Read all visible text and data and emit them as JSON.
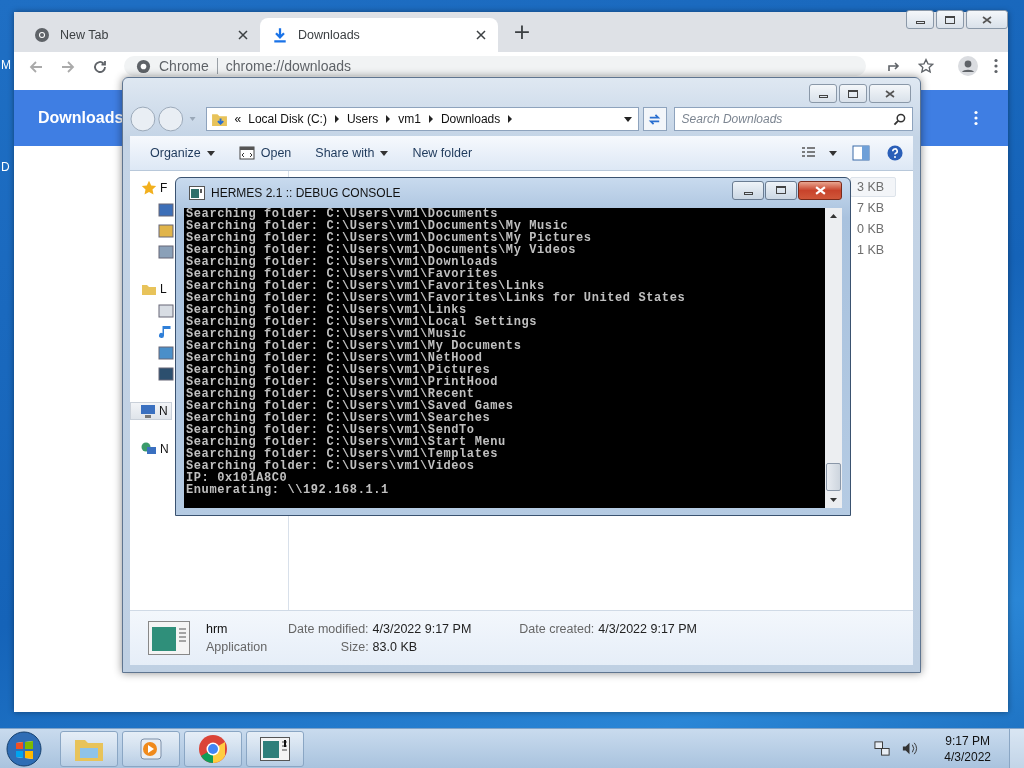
{
  "desktop": {
    "icon_labels": [
      "M",
      "D"
    ]
  },
  "browser": {
    "tabs": [
      {
        "title": "New Tab",
        "selected": false
      },
      {
        "title": "Downloads",
        "selected": true
      }
    ],
    "new_tab": "+",
    "address": {
      "site_label": "Chrome",
      "url": "chrome://downloads"
    },
    "page_title": "Downloads"
  },
  "explorer": {
    "breadcrumb_prefix": "«",
    "breadcrumb": [
      "Local Disk (C:)",
      "Users",
      "vm1",
      "Downloads"
    ],
    "search": {
      "placeholder": "Search Downloads"
    },
    "toolbar": [
      {
        "label": "Organize",
        "kind": "menu"
      },
      {
        "label": "Open",
        "kind": "icon"
      },
      {
        "label": "Share with",
        "kind": "menu"
      },
      {
        "label": "New folder",
        "kind": "plain"
      }
    ],
    "nav_groups": [
      {
        "kind": "star",
        "label": "F",
        "selected": false,
        "children": [
          {
            "kind": "desktop",
            "selected": false
          },
          {
            "kind": "downloads",
            "selected": false
          },
          {
            "kind": "recent",
            "selected": false
          }
        ]
      },
      {
        "kind": "libraries",
        "label": "L",
        "selected": false,
        "children": [
          {
            "kind": "documents",
            "selected": false
          },
          {
            "kind": "music",
            "selected": false
          },
          {
            "kind": "pictures",
            "selected": false
          },
          {
            "kind": "videos",
            "selected": false
          }
        ]
      },
      {
        "kind": "computer",
        "label": "N",
        "selected": true
      },
      {
        "kind": "network",
        "label": "N",
        "selected": false
      }
    ],
    "sizes": [
      {
        "text": "3 KB",
        "selected": true
      },
      {
        "text": "7 KB",
        "selected": false
      },
      {
        "text": "0 KB",
        "selected": false
      },
      {
        "text": "1 KB",
        "selected": false
      }
    ],
    "details": {
      "name": "hrm",
      "type": "Application",
      "fields": [
        {
          "label": "Date modified:",
          "value": "4/3/2022 9:17 PM"
        },
        {
          "label": "Size:",
          "value": "83.0 KB"
        },
        {
          "label": "Date created:",
          "value": "4/3/2022 9:17 PM"
        }
      ]
    }
  },
  "console": {
    "title": "HERMES 2.1 :: DEBUG CONSOLE",
    "lines": [
      "Searching folder: C:\\Users\\vm1\\Documents",
      "Searching folder: C:\\Users\\vm1\\Documents\\My Music",
      "Searching folder: C:\\Users\\vm1\\Documents\\My Pictures",
      "Searching folder: C:\\Users\\vm1\\Documents\\My Videos",
      "Searching folder: C:\\Users\\vm1\\Downloads",
      "Searching folder: C:\\Users\\vm1\\Favorites",
      "Searching folder: C:\\Users\\vm1\\Favorites\\Links",
      "Searching folder: C:\\Users\\vm1\\Favorites\\Links for United States",
      "Searching folder: C:\\Users\\vm1\\Links",
      "Searching folder: C:\\Users\\vm1\\Local Settings",
      "Searching folder: C:\\Users\\vm1\\Music",
      "Searching folder: C:\\Users\\vm1\\My Documents",
      "Searching folder: C:\\Users\\vm1\\NetHood",
      "Searching folder: C:\\Users\\vm1\\Pictures",
      "Searching folder: C:\\Users\\vm1\\PrintHood",
      "Searching folder: C:\\Users\\vm1\\Recent",
      "Searching folder: C:\\Users\\vm1\\Saved Games",
      "Searching folder: C:\\Users\\vm1\\Searches",
      "Searching folder: C:\\Users\\vm1\\SendTo",
      "Searching folder: C:\\Users\\vm1\\Start Menu",
      "Searching folder: C:\\Users\\vm1\\Templates",
      "Searching folder: C:\\Users\\vm1\\Videos",
      "IP: 0x101A8C0",
      "Enumerating: \\\\192.168.1.1"
    ]
  },
  "taskbar": {
    "time": "9:17 PM",
    "date": "4/3/2022"
  }
}
